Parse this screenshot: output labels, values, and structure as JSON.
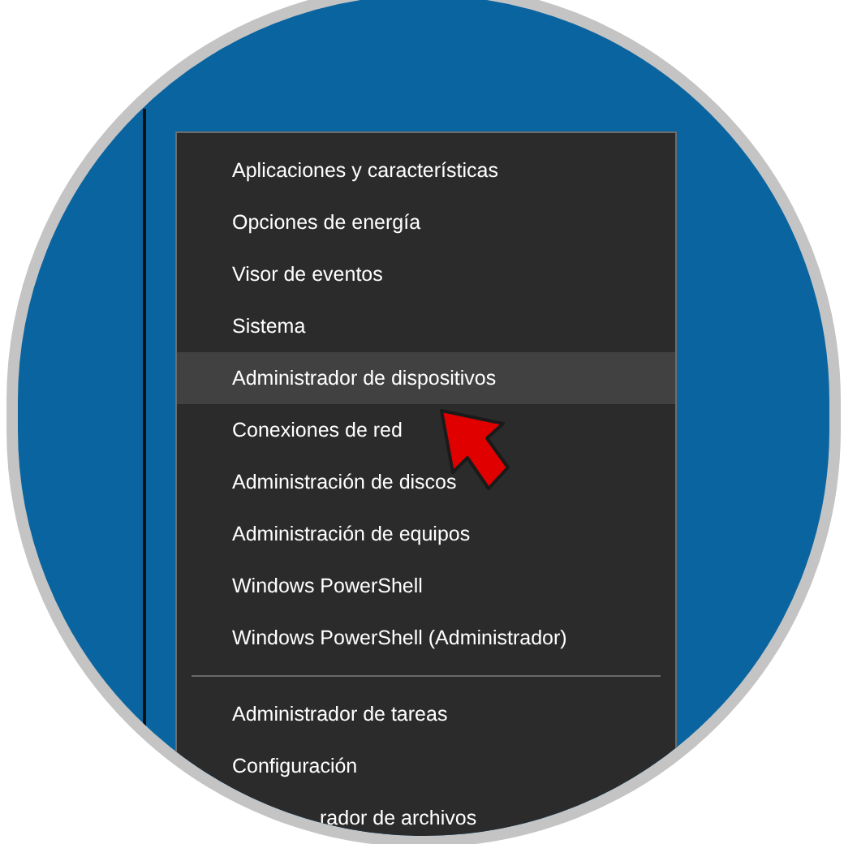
{
  "menu": {
    "groups": [
      {
        "items": [
          {
            "label": "Aplicaciones y características",
            "selected": false
          },
          {
            "label": "Opciones de energía",
            "selected": false
          },
          {
            "label": "Visor de eventos",
            "selected": false
          },
          {
            "label": "Sistema",
            "selected": false
          },
          {
            "label": "Administrador de dispositivos",
            "selected": true
          },
          {
            "label": "Conexiones de red",
            "selected": false
          },
          {
            "label": "Administración de discos",
            "selected": false
          },
          {
            "label": "Administración de equipos",
            "selected": false
          },
          {
            "label": "Windows PowerShell",
            "selected": false
          },
          {
            "label": "Windows PowerShell (Administrador)",
            "selected": false
          }
        ]
      },
      {
        "items": [
          {
            "label": "Administrador de tareas",
            "selected": false
          },
          {
            "label": "Configuración",
            "selected": false
          },
          {
            "label": "rador de archivos",
            "selected": false,
            "cut": true
          }
        ]
      }
    ]
  }
}
